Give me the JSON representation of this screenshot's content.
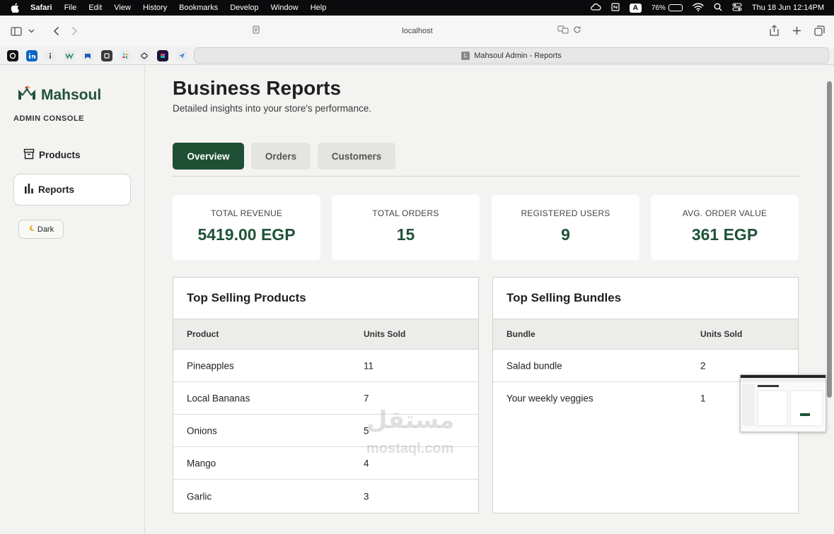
{
  "menubar": {
    "app": "Safari",
    "menus": [
      "File",
      "Edit",
      "View",
      "History",
      "Bookmarks",
      "Develop",
      "Window",
      "Help"
    ],
    "battery": "76%",
    "battery_level": 0.76,
    "input_badge": "A",
    "datetime": "Thu 18 Jun  12:14PM"
  },
  "browser": {
    "url": "localhost",
    "tab_title": "Mahsoul Admin - Reports",
    "tab_favicon": "L"
  },
  "sidebar": {
    "brand": "Mahsoul",
    "console_label": "ADMIN CONSOLE",
    "items": [
      {
        "label": "Products",
        "icon": "archive-icon"
      },
      {
        "label": "Reports",
        "icon": "bar-chart-icon"
      }
    ],
    "dark_toggle": "Dark"
  },
  "main": {
    "title": "Business Reports",
    "subtitle": "Detailed insights into your store's performance.",
    "tabs": [
      "Overview",
      "Orders",
      "Customers"
    ],
    "stats": [
      {
        "label": "TOTAL REVENUE",
        "value": "5419.00 EGP"
      },
      {
        "label": "TOTAL ORDERS",
        "value": "15"
      },
      {
        "label": "REGISTERED USERS",
        "value": "9"
      },
      {
        "label": "AVG. ORDER VALUE",
        "value": "361 EGP"
      }
    ],
    "products": {
      "title": "Top Selling Products",
      "headers": [
        "Product",
        "Units Sold"
      ],
      "rows": [
        [
          "Pineapples",
          "11"
        ],
        [
          "Local Bananas",
          "7"
        ],
        [
          "Onions",
          "5"
        ],
        [
          "Mango",
          "4"
        ],
        [
          "Garlic",
          "3"
        ]
      ]
    },
    "bundles": {
      "title": "Top Selling Bundles",
      "headers": [
        "Bundle",
        "Units Sold"
      ],
      "rows": [
        [
          "Salad bundle",
          "2"
        ],
        [
          "Your weekly veggies",
          "1"
        ]
      ]
    }
  },
  "watermark": {
    "arabic": "مستقل",
    "latin": "mostaql.com"
  },
  "colors": {
    "brand": "#215238",
    "active_tab": "#1f4f35"
  }
}
